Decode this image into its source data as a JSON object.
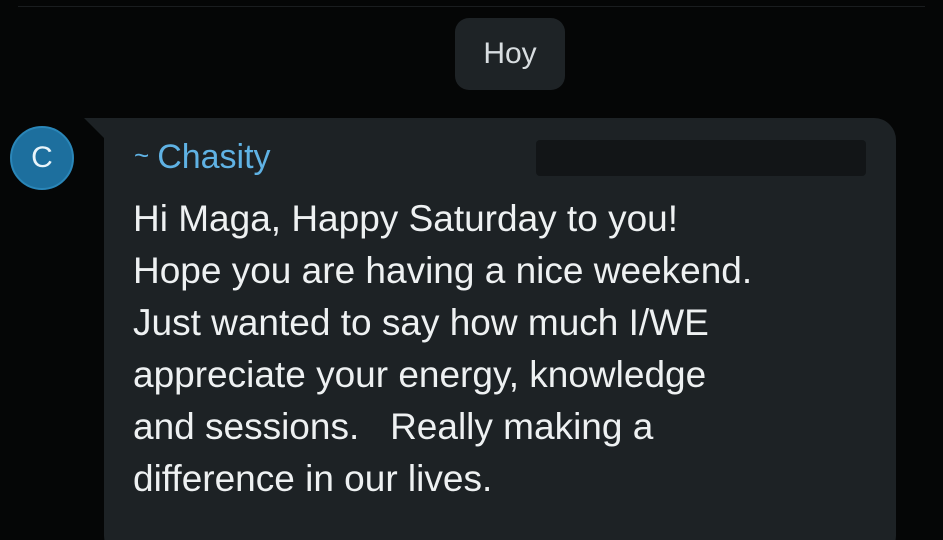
{
  "date_divider": {
    "label": "Hoy"
  },
  "message": {
    "avatar_initial": "C",
    "sender_prefix": "~",
    "sender_name": "Chasity",
    "text": "Hi Maga, Happy Saturday to you!\nHope you are having a nice weekend.\nJust wanted to say how much I/WE\nappreciate your energy, knowledge\nand sessions.   Really making a\ndifference in our lives."
  },
  "colors": {
    "background": "#050606",
    "bubble": "#1d2225",
    "sender_name": "#5fb2e4",
    "avatar": "#1d6f9e"
  }
}
